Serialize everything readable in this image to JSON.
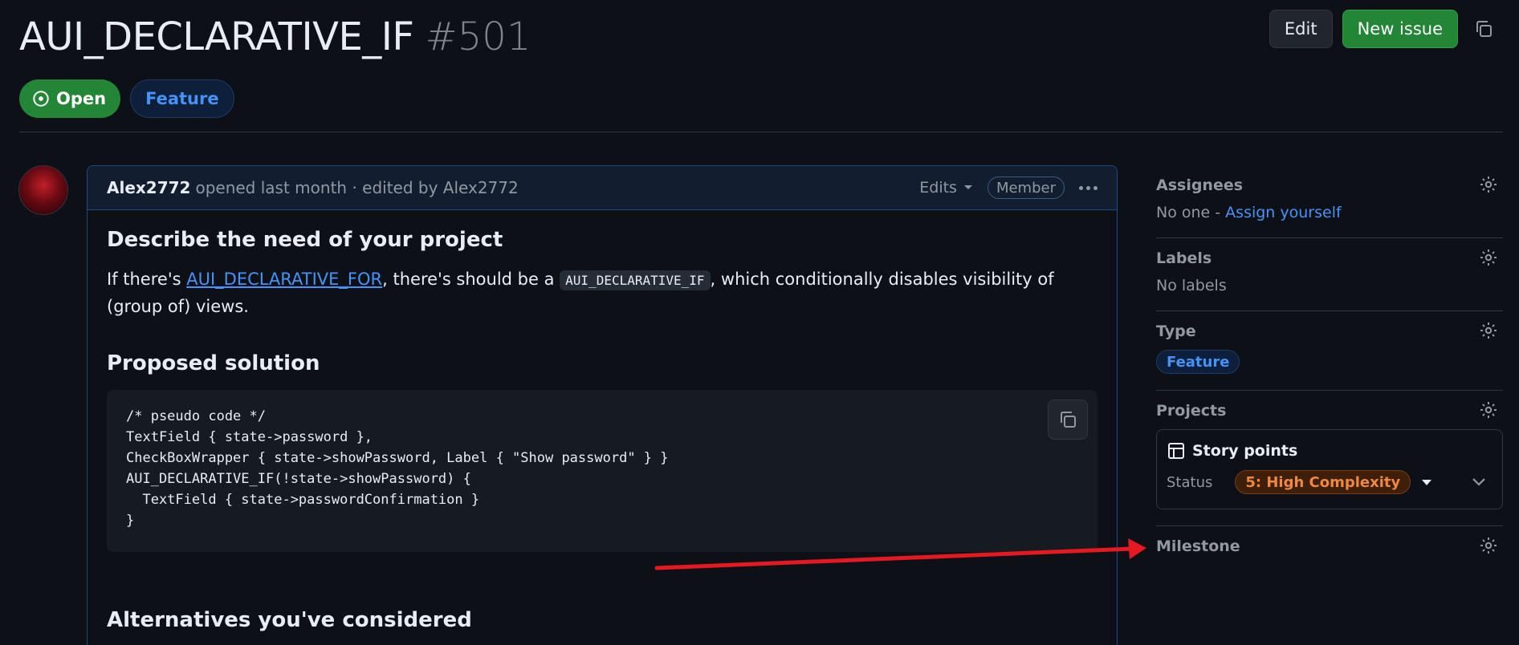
{
  "issue": {
    "title": "AUI_DECLARATIVE_IF",
    "number": "#501",
    "status": "Open",
    "label": "Feature"
  },
  "header_actions": {
    "edit": "Edit",
    "new_issue": "New issue"
  },
  "comment": {
    "author": "Alex2772",
    "meta": "opened last month · edited by Alex2772",
    "edits": "Edits",
    "role": "Member",
    "sections": {
      "need_heading": "Describe the need of your project",
      "need_text_1": "If there's ",
      "need_link": "AUI_DECLARATIVE_FOR",
      "need_text_2": ", there's should be a ",
      "need_code": "AUI_DECLARATIVE_IF",
      "need_text_3": ", which conditionally disables visibility of (group of) views.",
      "solution_heading": "Proposed solution",
      "code_lines": [
        "/* pseudo code */",
        "TextField { state->password },",
        "CheckBoxWrapper { state->showPassword, Label { \"Show password\" } }",
        "AUI_DECLARATIVE_IF(!state->showPassword) {",
        "  TextField { state->passwordConfirmation }",
        "}"
      ],
      "alternatives_heading": "Alternatives you've considered"
    }
  },
  "sidebar": {
    "assignees": {
      "title": "Assignees",
      "none": "No one - ",
      "assign": "Assign yourself"
    },
    "labels": {
      "title": "Labels",
      "value": "No labels"
    },
    "type": {
      "title": "Type",
      "value": "Feature"
    },
    "projects": {
      "title": "Projects",
      "project_name": "Story points",
      "status_label": "Status",
      "status_value": "5: High Complexity"
    },
    "milestone": {
      "title": "Milestone"
    }
  },
  "colors": {
    "background": "#0d1117",
    "accent_blue": "#4493f8",
    "open_green": "#238636",
    "complexity_orange": "#f0883e",
    "annotation_arrow": "#e5191f"
  }
}
